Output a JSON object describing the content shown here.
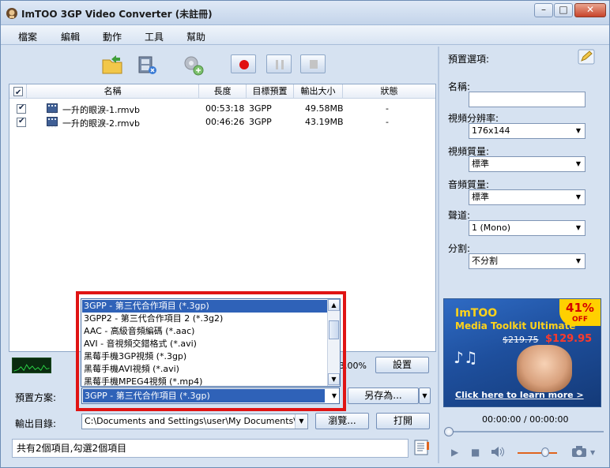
{
  "window": {
    "title": "ImTOO 3GP Video Converter (未註冊)",
    "controls": {
      "minimize": "–",
      "maximize": "□",
      "close": "✕"
    }
  },
  "menu": [
    "檔案",
    "編輯",
    "動作",
    "工具",
    "幫助"
  ],
  "file_list": {
    "columns": [
      "名稱",
      "長度",
      "目標預置",
      "輸出大小",
      "狀態"
    ],
    "rows": [
      {
        "checked": true,
        "name": "一升的眼淚-1.rmvb",
        "duration": "00:53:18",
        "preset": "3GPP",
        "size": "49.58MB",
        "status": "-"
      },
      {
        "checked": true,
        "name": "一升的眼淚-2.rmvb",
        "duration": "00:46:26",
        "preset": "3GPP",
        "size": "43.19MB",
        "status": "-"
      }
    ]
  },
  "progress": {
    "text": "3.00%"
  },
  "buttons": {
    "settings": "設置",
    "save_as": "另存為...",
    "browse": "瀏覽...",
    "open": "打開"
  },
  "preset_dropdown": {
    "options": [
      "3GPP - 第三代合作項目 (*.3gp)",
      "3GPP2 - 第三代合作項目 2 (*.3g2)",
      "AAC - 高級音頻編碼 (*.aac)",
      "AVI - 音視頻交錯格式 (*.avi)",
      "黑莓手機3GP視頻 (*.3gp)",
      "黑莓手機AVI視頻 (*.avi)",
      "黑莓手機MPEG4視頻 (*.mp4)"
    ],
    "selected_index": 0
  },
  "preset": {
    "label": "預置方案:",
    "value": "3GPP - 第三代合作項目 (*.3gp)"
  },
  "output": {
    "label": "輸出目錄:",
    "path": "C:\\Documents and Settings\\user\\My Documents\\My Vid"
  },
  "status_bar": {
    "text": "共有2個項目,勾選2個項目"
  },
  "right_panel": {
    "title": "預置選項:",
    "fields": {
      "name": {
        "label": "名稱:",
        "value": ""
      },
      "video_resolution": {
        "label": "視頻分辨率:",
        "value": "176x144"
      },
      "video_quality": {
        "label": "視頻質量:",
        "value": "標準"
      },
      "audio_quality": {
        "label": "音頻質量:",
        "value": "標準"
      },
      "channels": {
        "label": "聲道:",
        "value": "1 (Mono)"
      },
      "split": {
        "label": "分割:",
        "value": "不分割"
      }
    }
  },
  "banner": {
    "line1": "ImTOO",
    "line2": "Media Toolkit Ultimate",
    "discount": "41%",
    "discount_suffix": "OFF",
    "old_price": "$219.75",
    "new_price": "$129.95",
    "cta": "Click here to learn more >"
  },
  "player": {
    "time": "00:00:00 / 00:00:00"
  },
  "colors": {
    "highlight_frame": "#e01414",
    "selection": "#2f62b8",
    "window_bg": "#d6e2f1"
  }
}
